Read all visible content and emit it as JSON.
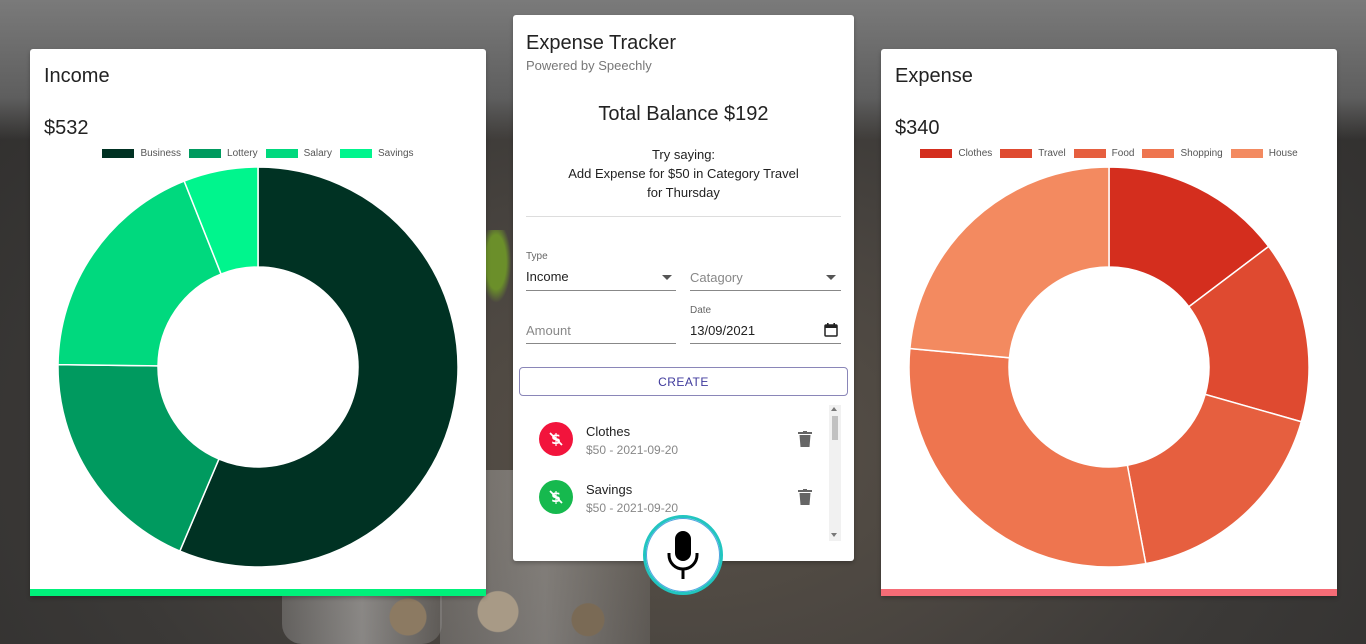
{
  "income": {
    "title": "Income",
    "amount": "$532",
    "bar_color": "#00f07a",
    "legend": [
      {
        "label": "Business",
        "color": "#003223"
      },
      {
        "label": "Lottery",
        "color": "#009a5f"
      },
      {
        "label": "Salary",
        "color": "#00d97e"
      },
      {
        "label": "Savings",
        "color": "#00f58d"
      }
    ]
  },
  "expense": {
    "title": "Expense",
    "amount": "$340",
    "bar_color": "#f56c76",
    "legend": [
      {
        "label": "Clothes",
        "color": "#d42e1e"
      },
      {
        "label": "Travel",
        "color": "#df4a30"
      },
      {
        "label": "Food",
        "color": "#e65f3f"
      },
      {
        "label": "Shopping",
        "color": "#ee754f"
      },
      {
        "label": "House",
        "color": "#f38a60"
      }
    ]
  },
  "chart_data": [
    {
      "type": "pie",
      "categories": [
        "Business",
        "Lottery",
        "Salary",
        "Savings"
      ],
      "values": [
        300,
        100,
        100,
        32
      ],
      "colors": [
        "#003223",
        "#009a5f",
        "#00d97e",
        "#00f58d"
      ],
      "legend_position": "top"
    },
    {
      "type": "pie",
      "categories": [
        "Clothes",
        "Travel",
        "Food",
        "Shopping",
        "House"
      ],
      "values": [
        50,
        50,
        60,
        100,
        80
      ],
      "colors": [
        "#d42e1e",
        "#df4a30",
        "#e65f3f",
        "#ee754f",
        "#f38a60"
      ],
      "legend_position": "top"
    }
  ],
  "tracker": {
    "title": "Expense Tracker",
    "subtitle": "Powered by Speechly",
    "balance": "Total Balance $192",
    "hint_line1": "Try saying:",
    "hint_line2": "Add Expense for $50 in Category Travel",
    "hint_line3": "for Thursday",
    "type_label": "Type",
    "type_value": "Income",
    "category_placeholder": "Catagory",
    "amount_placeholder": "Amount",
    "date_label": "Date",
    "date_value": "13/09/2021",
    "create_label": "CREATE"
  },
  "transactions": [
    {
      "name": "Clothes",
      "detail": "$50 - 2021-09-20",
      "color": "#f2143c",
      "icon": "dollar-off-icon"
    },
    {
      "name": "Savings",
      "detail": "$50 - 2021-09-20",
      "color": "#16b94e",
      "icon": "dollar-off-icon"
    }
  ]
}
